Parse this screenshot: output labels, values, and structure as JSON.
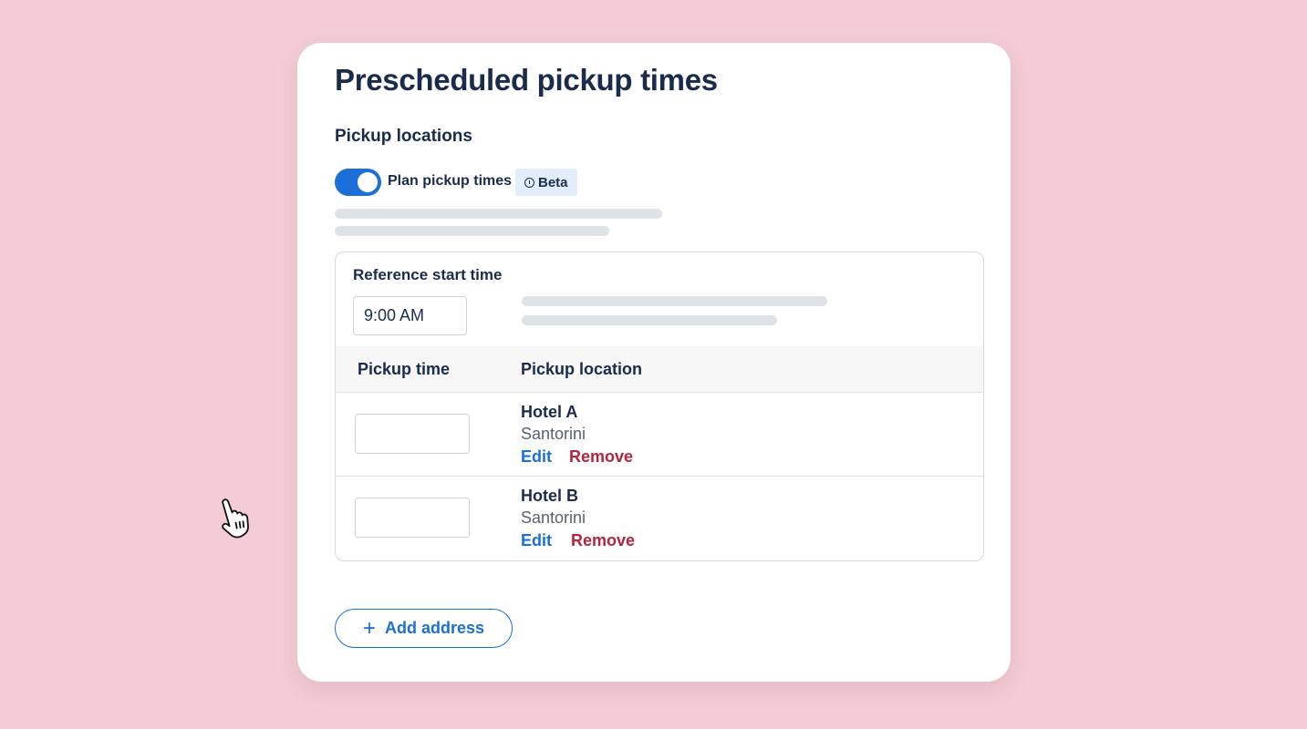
{
  "card": {
    "title": "Prescheduled pickup times",
    "section_title": "Pickup locations",
    "toggle": {
      "label": "Plan pickup times",
      "state": "on",
      "color": "#1b6fd9"
    },
    "badge": {
      "icon": "info-icon",
      "label": "Beta"
    }
  },
  "reference": {
    "label": "Reference start time",
    "value": "9:00 AM"
  },
  "table": {
    "headers": [
      "Pickup time",
      "Pickup location"
    ],
    "rows": [
      {
        "pickup_time": "",
        "name": "Hotel A",
        "city": "Santorini",
        "edit_label": "Edit",
        "remove_label": "Remove"
      },
      {
        "pickup_time": "",
        "name": "Hotel B",
        "city": "Santorini",
        "edit_label": "Edit",
        "remove_label": "Remove"
      }
    ]
  },
  "actions": {
    "add_icon": "plus-icon",
    "add_label": "Add address"
  },
  "colors": {
    "background": "#f3ccd5",
    "primary": "#1b6fd9",
    "danger": "#b3263d",
    "text": "#1a2b4c",
    "badge_bg": "#e2eefc"
  },
  "pointer": {
    "icon": "hand-pointer-icon"
  }
}
